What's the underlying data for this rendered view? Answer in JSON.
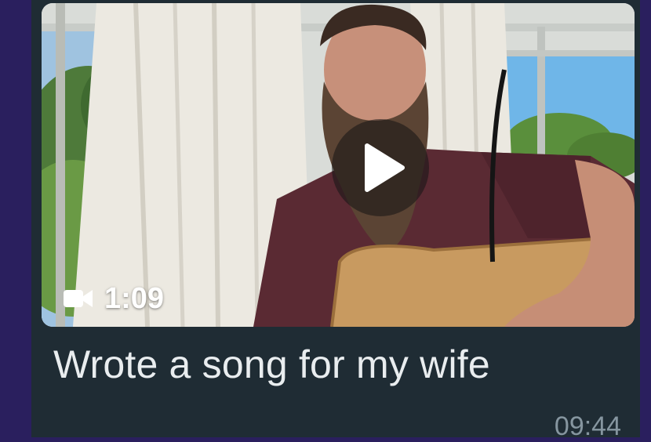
{
  "message": {
    "video": {
      "duration": "1:09",
      "duration_icon": "video-camera-icon",
      "play_icon": "play-icon"
    },
    "caption": "Wrote a song for my wife",
    "timestamp": "09:44"
  },
  "colors": {
    "chat_background": "#2a1f5e",
    "bubble": "#1f2c34",
    "caption_text": "#e9edef",
    "timestamp_text": "#8696a0"
  }
}
